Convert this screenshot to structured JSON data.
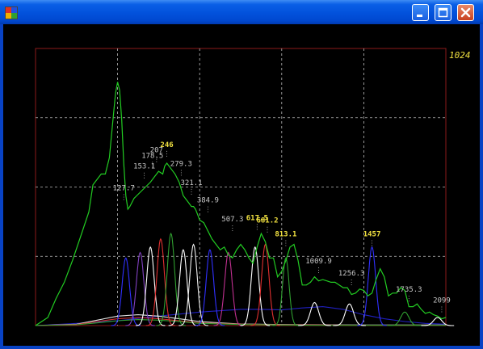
{
  "window": {
    "title": "",
    "icon": "application-icon"
  },
  "controls": {
    "minimize": "minimize-icon",
    "maximize": "maximize-icon",
    "close": "close-icon"
  },
  "colors": {
    "background": "#000000",
    "frame": "#8B1A1A",
    "grid": "#BBBBBB",
    "label_gray": "#C8C8C8",
    "label_yellow": "#F0E040",
    "total": "#22CC22"
  },
  "chart_data": {
    "type": "line",
    "title": "",
    "xlabel": "",
    "ylabel": "",
    "xlim": [
      0,
      100
    ],
    "ylim": [
      0,
      1024
    ],
    "y_max_label": "1024",
    "grid": true,
    "total_series": {
      "name": "",
      "color": "#22CC22",
      "x": [
        0,
        3,
        5,
        7,
        9,
        11,
        13,
        14,
        16,
        17,
        18,
        19,
        19.5,
        20,
        20.5,
        21,
        21.5,
        22,
        22.5,
        23,
        24,
        26,
        28,
        29,
        30,
        31,
        31.5,
        32,
        32.5,
        33,
        34,
        35,
        36,
        37,
        38,
        38.5,
        39,
        39.5,
        40,
        41,
        42,
        43,
        44,
        45,
        46,
        47,
        48,
        49,
        50,
        51,
        52,
        53,
        54,
        55,
        56,
        57,
        58,
        59,
        60,
        61,
        62,
        63,
        64,
        65,
        66,
        67,
        68,
        69,
        70,
        71,
        72,
        73,
        74,
        75,
        76,
        77,
        78,
        79,
        80,
        81,
        82,
        83,
        84,
        85,
        86,
        87,
        88,
        89,
        90,
        91,
        92,
        93,
        94,
        95,
        96,
        97,
        98,
        99,
        100
      ],
      "y": [
        0,
        30,
        100,
        160,
        240,
        330,
        420,
        520,
        560,
        560,
        620,
        780,
        860,
        900,
        870,
        760,
        600,
        480,
        430,
        440,
        470,
        500,
        530,
        550,
        570,
        560,
        590,
        600,
        590,
        580,
        560,
        530,
        480,
        460,
        440,
        440,
        430,
        410,
        390,
        380,
        350,
        320,
        300,
        280,
        290,
        260,
        250,
        280,
        300,
        280,
        250,
        230,
        290,
        340,
        310,
        250,
        250,
        180,
        200,
        240,
        290,
        300,
        240,
        150,
        150,
        160,
        180,
        165,
        170,
        165,
        160,
        160,
        150,
        140,
        140,
        115,
        120,
        135,
        130,
        110,
        120,
        170,
        210,
        180,
        110,
        120,
        120,
        140,
        130,
        70,
        70,
        80,
        60,
        45,
        50,
        40,
        35,
        25,
        30,
        35
      ]
    },
    "peaks": [
      {
        "x": 21.5,
        "value": "127.7",
        "y": 500
      },
      {
        "x": 26.5,
        "value": "153.1",
        "y": 580
      },
      {
        "x": 28.5,
        "value": "178.5",
        "y": 620
      },
      {
        "x": 29.5,
        "value": "207",
        "y": 640
      },
      {
        "x": 32,
        "value": "246",
        "y": 660,
        "highlight": true
      },
      {
        "x": 35.5,
        "value": "279.3",
        "y": 590
      },
      {
        "x": 38,
        "value": "321.1",
        "y": 520
      },
      {
        "x": 42,
        "value": "384.9",
        "y": 455
      },
      {
        "x": 48,
        "value": "507.3",
        "y": 385
      },
      {
        "x": 54,
        "value": "617.5",
        "y": 390,
        "highlight": true
      },
      {
        "x": 56.5,
        "value": "681.2",
        "y": 380,
        "highlight": true
      },
      {
        "x": 61,
        "value": "813.1",
        "y": 330,
        "highlight": true
      },
      {
        "x": 69,
        "value": "1009.9",
        "y": 230
      },
      {
        "x": 77,
        "value": "1256.3",
        "y": 185
      },
      {
        "x": 82,
        "value": "1457",
        "y": 330,
        "highlight": true
      },
      {
        "x": 91,
        "value": "1735.3",
        "y": 125
      },
      {
        "x": 99,
        "value": "2099",
        "y": 85
      }
    ],
    "component_peaks": [
      {
        "center": 22,
        "height": 250,
        "width": 0.9,
        "color": "#3030FF"
      },
      {
        "center": 25.5,
        "height": 270,
        "width": 0.9,
        "color": "#8040C0"
      },
      {
        "center": 28,
        "height": 290,
        "width": 0.9,
        "color": "#FFFFFF"
      },
      {
        "center": 30.5,
        "height": 320,
        "width": 0.9,
        "color": "#E03030"
      },
      {
        "center": 33,
        "height": 340,
        "width": 0.9,
        "color": "#30A030"
      },
      {
        "center": 36,
        "height": 280,
        "width": 0.9,
        "color": "#FFFFFF"
      },
      {
        "center": 38.5,
        "height": 300,
        "width": 0.9,
        "color": "#F0F0F0"
      },
      {
        "center": 42.5,
        "height": 280,
        "width": 0.9,
        "color": "#3030FF"
      },
      {
        "center": 47,
        "height": 270,
        "width": 0.9,
        "color": "#C03090"
      },
      {
        "center": 53.5,
        "height": 290,
        "width": 0.9,
        "color": "#FFFFFF"
      },
      {
        "center": 56,
        "height": 300,
        "width": 0.9,
        "color": "#E03030"
      },
      {
        "center": 61,
        "height": 250,
        "width": 0.8,
        "color": "#30A030"
      },
      {
        "center": 68,
        "height": 85,
        "width": 1.0,
        "color": "#FFFFFF"
      },
      {
        "center": 76.5,
        "height": 80,
        "width": 1.0,
        "color": "#FFFFFF"
      },
      {
        "center": 82,
        "height": 290,
        "width": 0.9,
        "color": "#3030FF"
      },
      {
        "center": 90,
        "height": 50,
        "width": 1.0,
        "color": "#30A030"
      },
      {
        "center": 98,
        "height": 30,
        "width": 1.0,
        "color": "#FFFFFF"
      }
    ],
    "broad_curves": [
      {
        "color": "#2020C0",
        "x": [
          0,
          10,
          20,
          30,
          40,
          50,
          55,
          60,
          65,
          70,
          75,
          80,
          85,
          90,
          95,
          100
        ],
        "y": [
          0,
          8,
          18,
          35,
          50,
          60,
          60,
          58,
          65,
          70,
          60,
          40,
          25,
          15,
          8,
          5
        ]
      },
      {
        "color": "#E0E0E0",
        "x": [
          0,
          10,
          15,
          20,
          25,
          30,
          35,
          40,
          45,
          50,
          60,
          70,
          80,
          90,
          100
        ],
        "y": [
          0,
          5,
          20,
          35,
          40,
          35,
          25,
          15,
          10,
          6,
          4,
          3,
          2,
          2,
          2
        ]
      },
      {
        "color": "#D03030",
        "x": [
          0,
          10,
          15,
          20,
          25,
          30,
          35,
          40,
          50,
          60,
          70,
          80,
          90,
          100
        ],
        "y": [
          0,
          4,
          15,
          25,
          30,
          25,
          18,
          10,
          5,
          3,
          2,
          1,
          1,
          1
        ]
      },
      {
        "color": "#30A030",
        "x": [
          0,
          10,
          15,
          20,
          25,
          30,
          35,
          40,
          50,
          60,
          70,
          80,
          90,
          100
        ],
        "y": [
          0,
          3,
          10,
          18,
          22,
          20,
          15,
          8,
          4,
          2,
          1,
          1,
          1,
          1
        ]
      }
    ]
  }
}
